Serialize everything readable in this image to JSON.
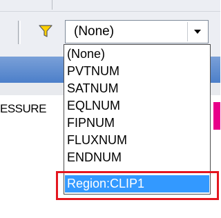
{
  "toolbar": {
    "filter_icon": "funnel-filter-icon",
    "combo_value": "(None)",
    "combo_arrow_icon": "triangle-down-icon"
  },
  "background": {
    "side_label": "ESSURE"
  },
  "dropdown": {
    "options": [
      "(None)",
      "PVTNUM",
      "SATNUM",
      "EQLNUM",
      "FIPNUM",
      "FLUXNUM",
      "ENDNUM",
      "Region:CLIP1"
    ],
    "selected_index": 7
  },
  "colors": {
    "selection": "#3399ff",
    "callout": "#e4161f",
    "filter_icon": "#ffd000",
    "accent_mark": "#e8008a"
  }
}
